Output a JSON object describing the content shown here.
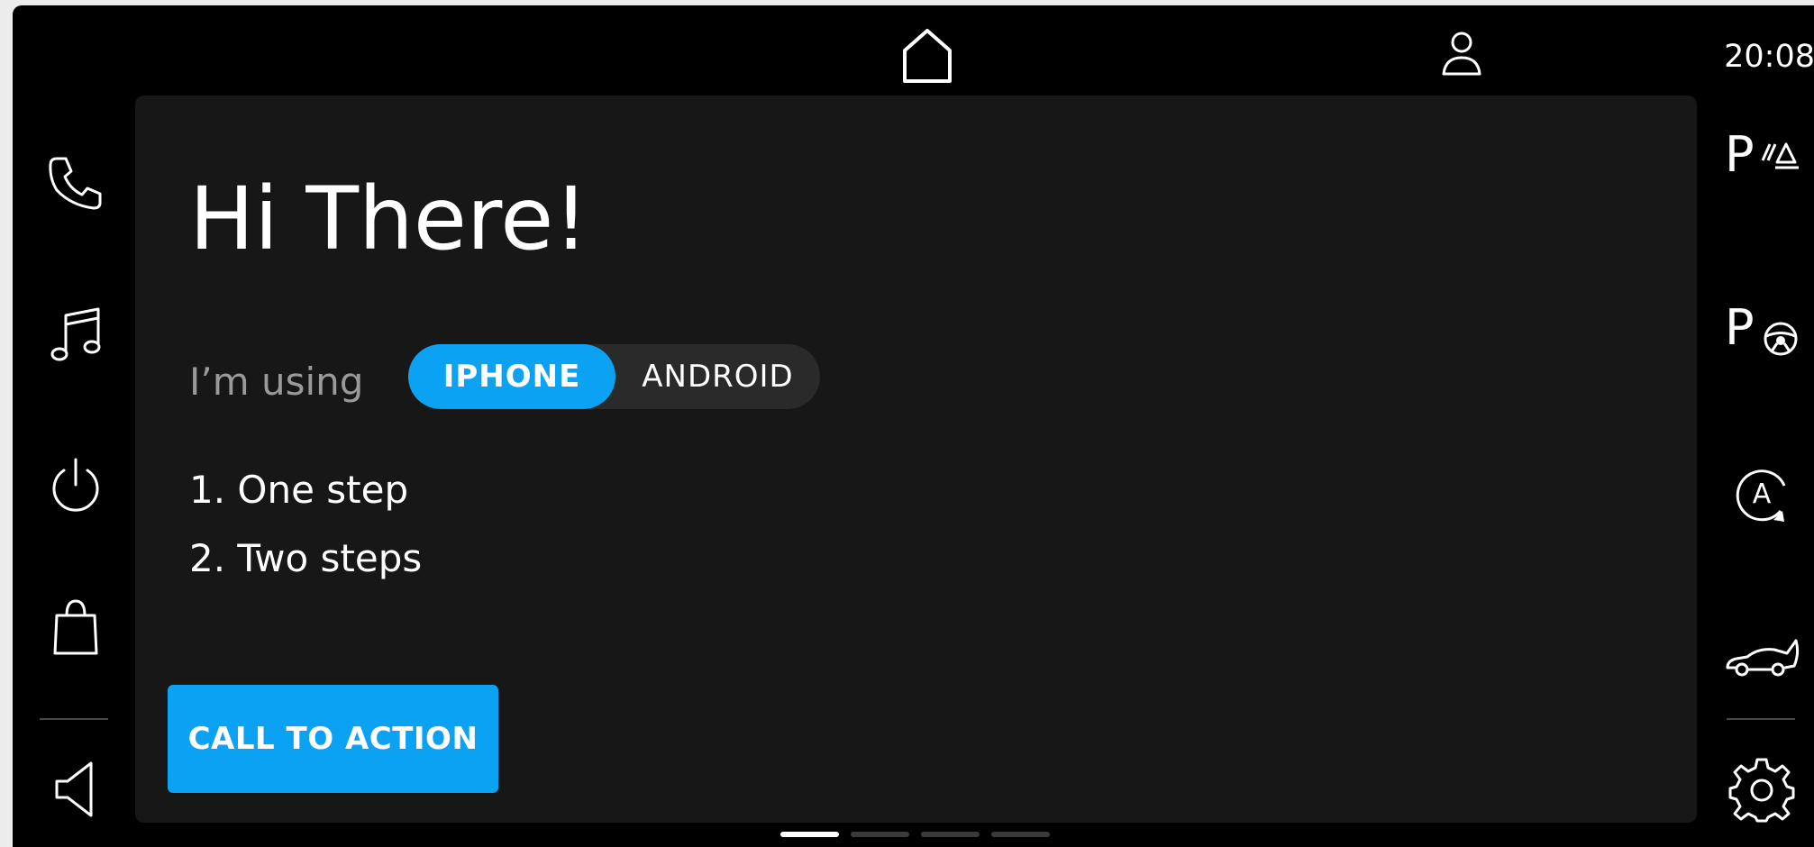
{
  "status_bar": {
    "time": "20:08",
    "home_icon": "home-icon",
    "profile_icon": "profile-icon"
  },
  "left_rail": [
    {
      "icon": "phone-icon"
    },
    {
      "icon": "music-note-icon"
    },
    {
      "icon": "power-icon"
    },
    {
      "icon": "shopping-bag-icon"
    },
    {
      "icon": "volume-icon"
    }
  ],
  "right_rail": [
    {
      "icon": "park-assist-sensors-icon",
      "letter": "P"
    },
    {
      "icon": "park-steering-icon",
      "letter": "P"
    },
    {
      "icon": "auto-start-stop-icon",
      "letter": "A"
    },
    {
      "icon": "car-trunk-icon"
    },
    {
      "icon": "settings-gear-icon"
    }
  ],
  "main": {
    "title": "Hi There!",
    "using_label": "I’m using",
    "toggle": {
      "options": [
        "IPHONE",
        "ANDROID"
      ],
      "selected": "IPHONE"
    },
    "steps": [
      "1. One step",
      "2. Two steps"
    ],
    "cta_label": "CALL TO ACTION"
  },
  "pager": {
    "pages": 4,
    "current": 1
  },
  "colors": {
    "accent": "#0ba2f3",
    "background": "#000000",
    "card": "#171717",
    "muted_text": "#9a9a9a"
  }
}
